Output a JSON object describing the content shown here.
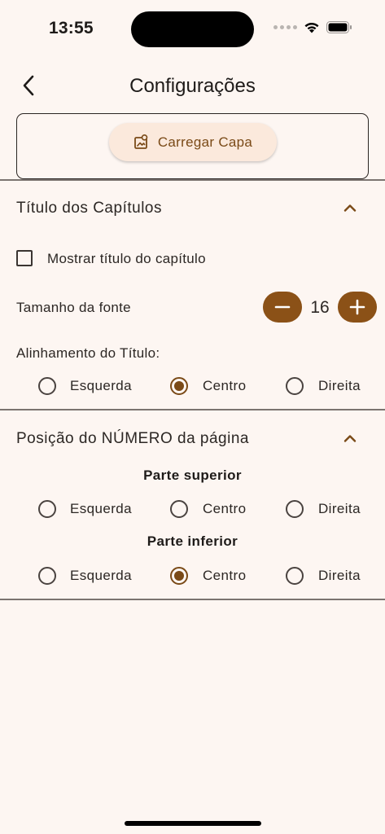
{
  "status_bar": {
    "time": "13:55"
  },
  "header": {
    "title": "Configurações"
  },
  "cover": {
    "button_label": "Carregar Capa"
  },
  "chapter_titles": {
    "section_title": "Título dos Capítulos",
    "show_title_label": "Mostrar título do capítulo",
    "show_title_checked": false,
    "font_size_label": "Tamanho da fonte",
    "font_size_value": "16",
    "alignment_label": "Alinhamento do Título:",
    "alignment_options": [
      "Esquerda",
      "Centro",
      "Direita"
    ],
    "alignment_selected": "Centro"
  },
  "page_number": {
    "section_title": "Posição do NÚMERO da página",
    "top_label": "Parte superior",
    "top_options": [
      "Esquerda",
      "Centro",
      "Direita"
    ],
    "top_selected": null,
    "bottom_label": "Parte inferior",
    "bottom_options": [
      "Esquerda",
      "Centro",
      "Direita"
    ],
    "bottom_selected": "Centro"
  },
  "colors": {
    "background": "#fdf6f2",
    "accent": "#8b5117",
    "accent_text": "#7a4a17",
    "button_tint": "#fbe9dc"
  }
}
